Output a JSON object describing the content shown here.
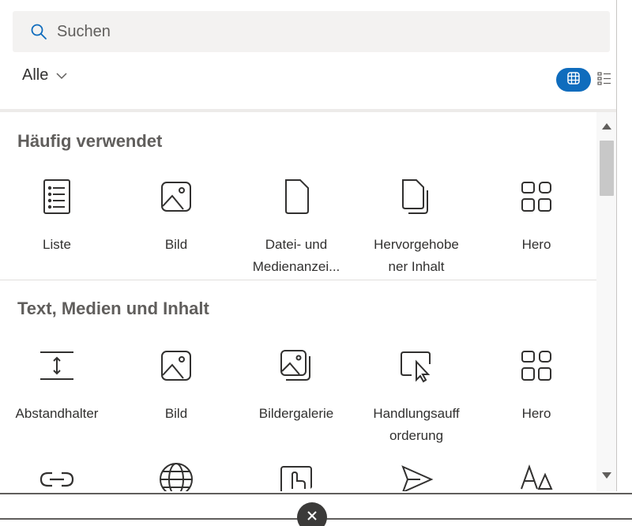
{
  "search": {
    "placeholder": "Suchen"
  },
  "filter": {
    "label": "Alle"
  },
  "view": {
    "grid_active": true
  },
  "colors": {
    "accent": "#0f6cbd",
    "section_title": "#605e5c"
  },
  "sections": [
    {
      "title": "Häufig verwendet",
      "items": [
        {
          "label_line1": "Liste",
          "label_line2": "",
          "icon": "list-icon"
        },
        {
          "label_line1": "Bild",
          "label_line2": "",
          "icon": "image-icon"
        },
        {
          "label_line1": "Datei- und",
          "label_line2": "Medienanzei...",
          "icon": "file-icon"
        },
        {
          "label_line1": "Hervorgehobe",
          "label_line2": "ner Inhalt",
          "icon": "highlighted-content-icon"
        },
        {
          "label_line1": "Hero",
          "label_line2": "",
          "icon": "hero-icon"
        }
      ]
    },
    {
      "title": "Text, Medien und Inhalt",
      "items": [
        {
          "label_line1": "Abstandhalter",
          "label_line2": "",
          "icon": "spacer-icon"
        },
        {
          "label_line1": "Bild",
          "label_line2": "",
          "icon": "image-icon"
        },
        {
          "label_line1": "Bildergalerie",
          "label_line2": "",
          "icon": "image-gallery-icon"
        },
        {
          "label_line1": "Handlungsauff",
          "label_line2": "orderung",
          "icon": "call-to-action-icon"
        },
        {
          "label_line1": "Hero",
          "label_line2": "",
          "icon": "hero-icon"
        }
      ]
    },
    {
      "items": [
        {
          "icon": "link-icon"
        },
        {
          "icon": "globe-icon"
        },
        {
          "icon": "embed-icon"
        },
        {
          "icon": "send-icon"
        },
        {
          "icon": "text-icon"
        }
      ]
    }
  ]
}
